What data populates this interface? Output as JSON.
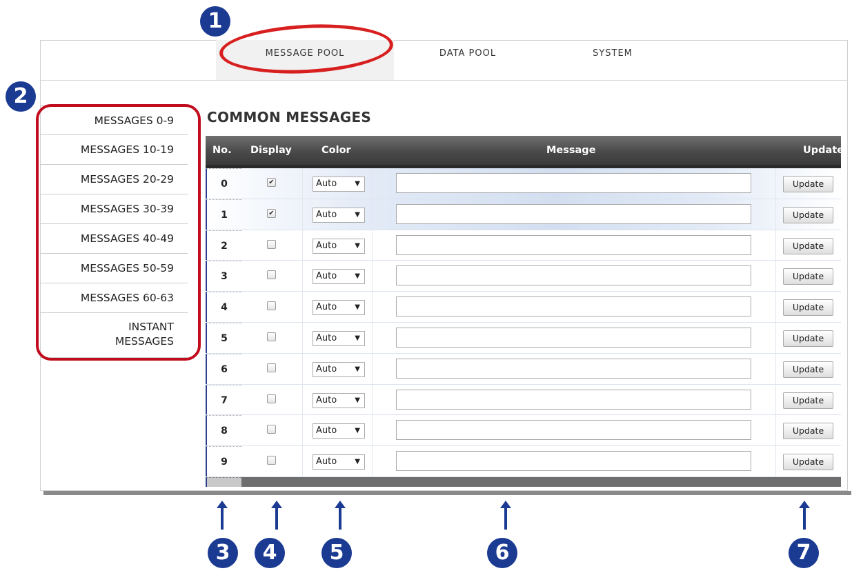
{
  "nav": {
    "tabs": [
      {
        "label": "MESSAGE POOL",
        "active": true
      },
      {
        "label": "DATA POOL",
        "active": false
      },
      {
        "label": "SYSTEM",
        "active": false
      }
    ]
  },
  "sidebar": {
    "items": [
      {
        "label": "MESSAGES 0-9"
      },
      {
        "label": "MESSAGES 10-19"
      },
      {
        "label": "MESSAGES 20-29"
      },
      {
        "label": "MESSAGES 30-39"
      },
      {
        "label": "MESSAGES 40-49"
      },
      {
        "label": "MESSAGES 50-59"
      },
      {
        "label": "MESSAGES 60-63"
      },
      {
        "label_line1": "INSTANT",
        "label_line2": "MESSAGES"
      }
    ]
  },
  "main": {
    "heading": "COMMON MESSAGES",
    "columns": {
      "no": "No.",
      "display": "Display",
      "color": "Color",
      "message": "Message",
      "update": "Update"
    },
    "rows": [
      {
        "no": "0",
        "display": true,
        "color": "Auto",
        "message": "",
        "button": "Update"
      },
      {
        "no": "1",
        "display": true,
        "color": "Auto",
        "message": "",
        "button": "Update"
      },
      {
        "no": "2",
        "display": false,
        "color": "Auto",
        "message": "",
        "button": "Update"
      },
      {
        "no": "3",
        "display": false,
        "color": "Auto",
        "message": "",
        "button": "Update"
      },
      {
        "no": "4",
        "display": false,
        "color": "Auto",
        "message": "",
        "button": "Update"
      },
      {
        "no": "5",
        "display": false,
        "color": "Auto",
        "message": "",
        "button": "Update"
      },
      {
        "no": "6",
        "display": false,
        "color": "Auto",
        "message": "",
        "button": "Update"
      },
      {
        "no": "7",
        "display": false,
        "color": "Auto",
        "message": "",
        "button": "Update"
      },
      {
        "no": "8",
        "display": false,
        "color": "Auto",
        "message": "",
        "button": "Update"
      },
      {
        "no": "9",
        "display": false,
        "color": "Auto",
        "message": "",
        "button": "Update"
      }
    ]
  },
  "annotations": {
    "badges": [
      "1",
      "2",
      "3",
      "4",
      "5",
      "6",
      "7"
    ],
    "badge_color": "#1b3b93",
    "highlight_color": "#d81f1f"
  }
}
